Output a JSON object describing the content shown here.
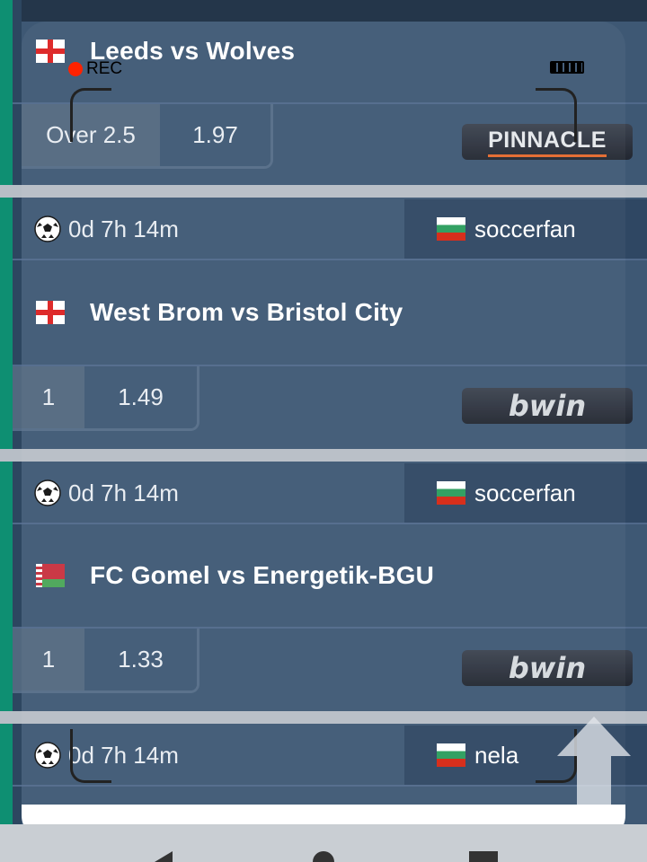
{
  "recorder": {
    "rec_label": "REC"
  },
  "bets": [
    {
      "match": "Leeds vs Wolves",
      "flag": "england",
      "pick": "Over 2.5",
      "odds": "1.97",
      "bookmaker": "PINNACLE"
    },
    {
      "time_left": "0d 7h 14m",
      "tipster": "soccerfan",
      "tipster_flag": "bulgaria",
      "match": "West Brom vs Bristol City",
      "flag": "england",
      "pick": "1",
      "odds": "1.49",
      "bookmaker": "bwin"
    },
    {
      "time_left": "0d 7h 14m",
      "tipster": "soccerfan",
      "tipster_flag": "bulgaria",
      "match": "FC Gomel vs Energetik-BGU",
      "flag": "belarus",
      "pick": "1",
      "odds": "1.33",
      "bookmaker": "bwin"
    },
    {
      "time_left": "0d 7h 14m",
      "tipster": "nela",
      "tipster_flag": "bulgaria"
    }
  ],
  "icons": {
    "sport": "soccer-ball-icon",
    "scroll_top": "arrow-up-icon"
  }
}
